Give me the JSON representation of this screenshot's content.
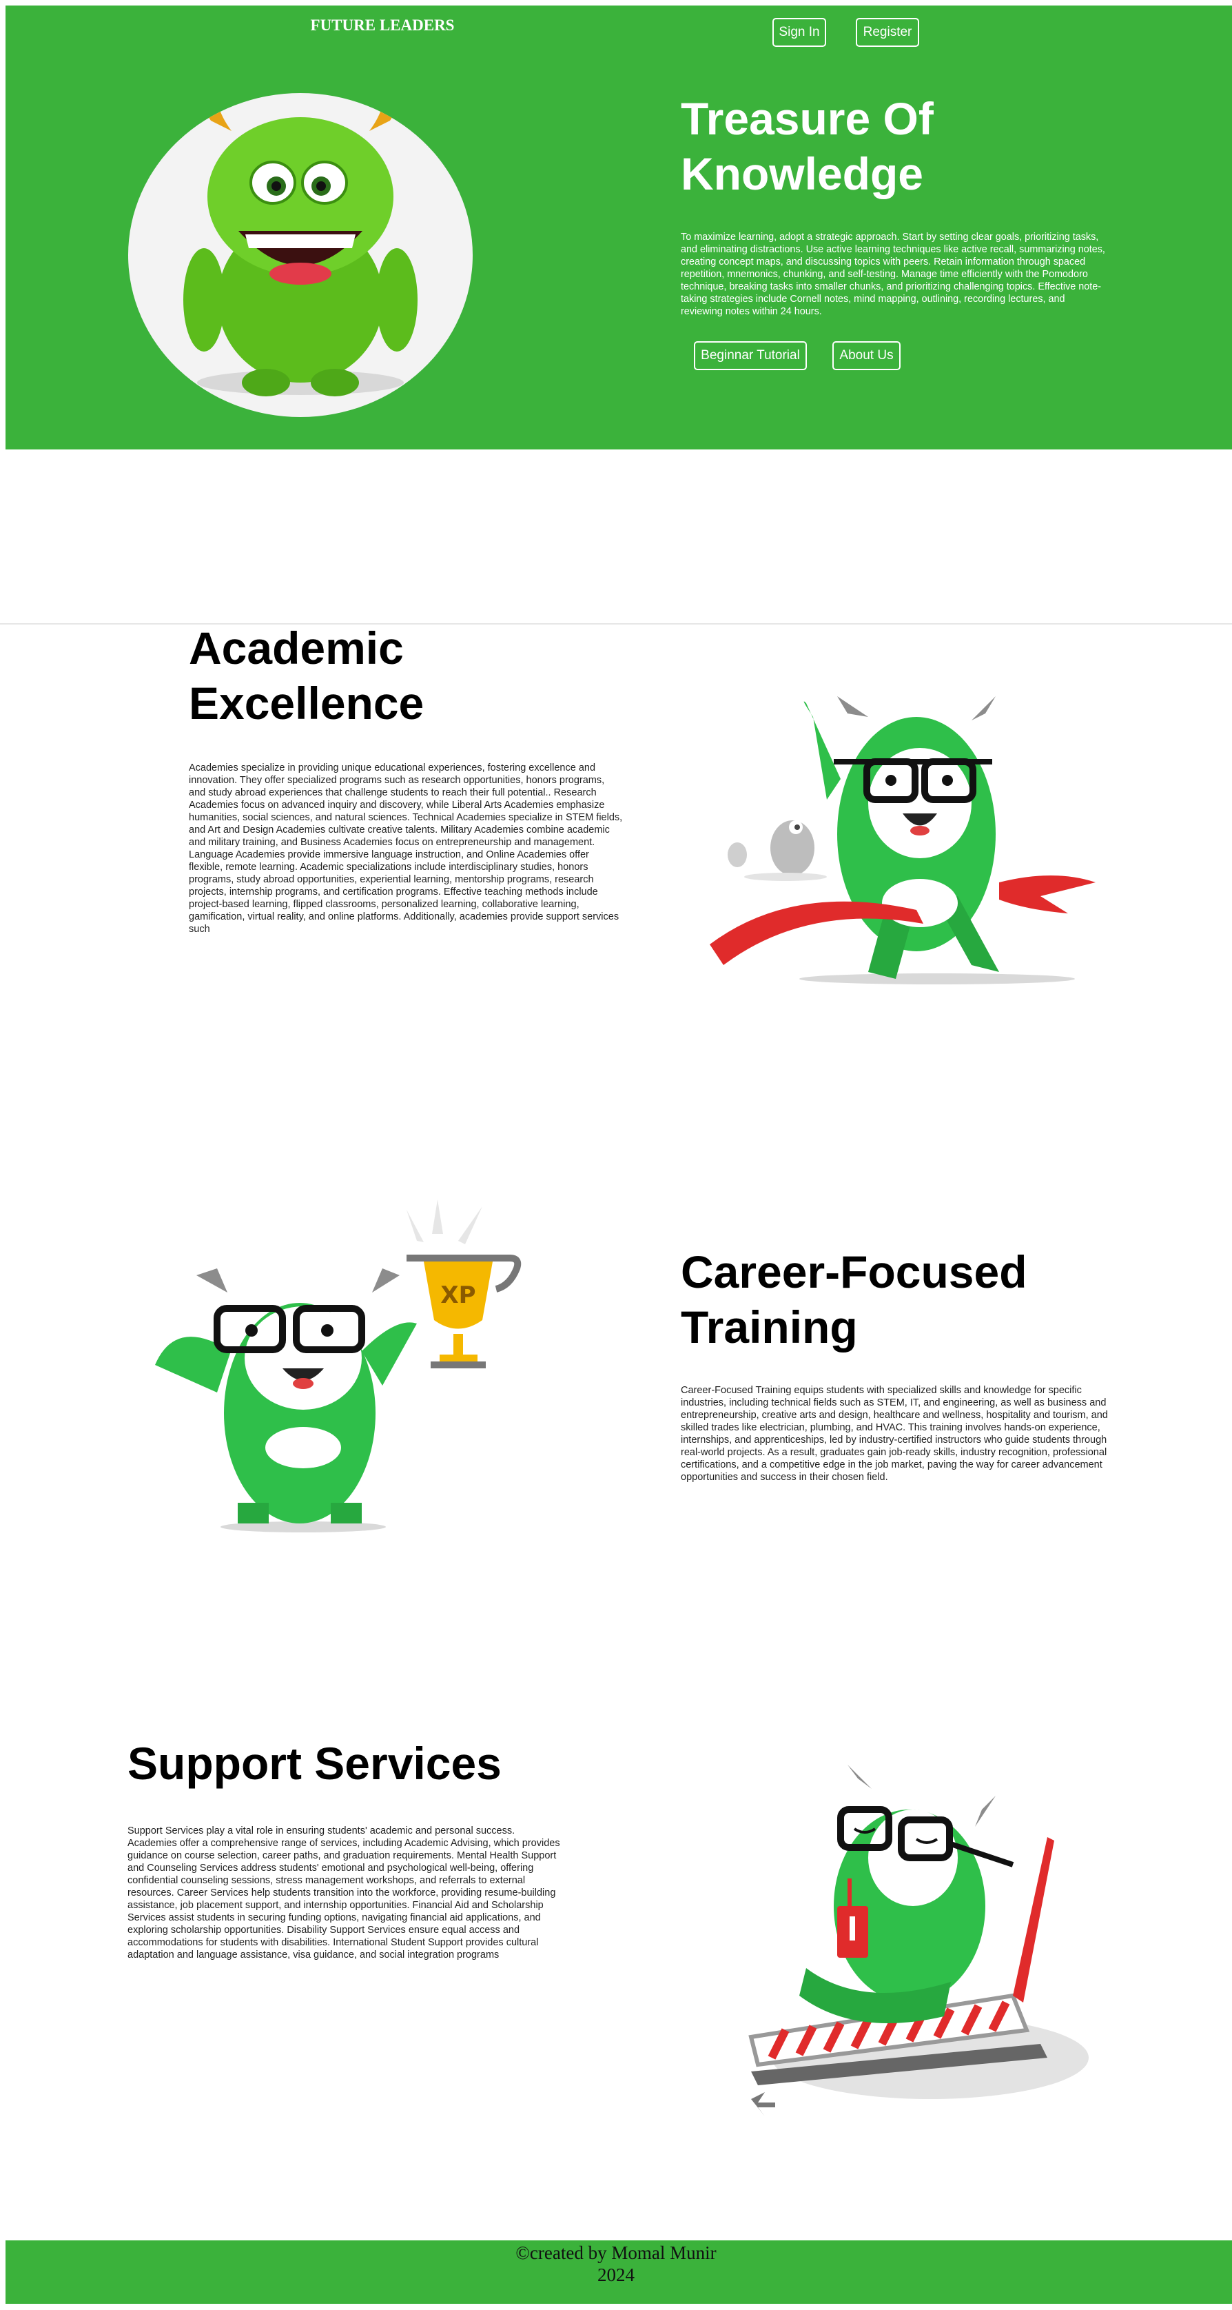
{
  "header": {
    "brand": "FUTURE LEADERS",
    "signin_label": "Sign In",
    "register_label": "Register"
  },
  "hero": {
    "title": "Treasure Of Knowledge",
    "text": "To maximize learning, adopt a strategic approach. Start by setting clear goals, prioritizing tasks, and eliminating distractions. Use active learning techniques like active recall, summarizing notes, creating concept maps, and discussing topics with peers. Retain information through spaced repetition, mnemonics, chunking, and self-testing. Manage time efficiently with the Pomodoro technique, breaking tasks into smaller chunks, and prioritizing challenging topics. Effective note-taking strategies include Cornell notes, mind mapping, outlining, recording lectures, and reviewing notes within 24 hours.",
    "tutorial_label": "Beginnar Tutorial",
    "about_label": "About Us"
  },
  "sections": [
    {
      "title": "Academic Excellence",
      "text": "Academies specialize in providing unique educational experiences, fostering excellence and innovation. They offer specialized programs such as research opportunities, honors programs, and study abroad experiences that challenge students to reach their full potential.. Research Academies focus on advanced inquiry and discovery, while Liberal Arts Academies emphasize humanities, social sciences, and natural sciences. Technical Academies specialize in STEM fields, and Art and Design Academies cultivate creative talents. Military Academies combine academic and military training, and Business Academies focus on entrepreneurship and management. Language Academies provide immersive language instruction, and Online Academies offer flexible, remote learning. Academic specializations include interdisciplinary studies, honors programs, study abroad opportunities, experiential learning, mentorship programs, research projects, internship programs, and certification programs. Effective teaching methods include project-based learning, flipped classrooms, personalized learning, collaborative learning, gamification, virtual reality, and online platforms. Additionally, academies provide support services such"
    },
    {
      "title": "Career-Focused Training",
      "text": "Career-Focused Training equips students with specialized skills and knowledge for specific industries, including technical fields such as STEM, IT, and engineering, as well as business and entrepreneurship, creative arts and design, healthcare and wellness, hospitality and tourism, and skilled trades like electrician, plumbing, and HVAC. This training involves hands-on experience, internships, and apprenticeships, led by industry-certified instructors who guide students through real-world projects. As a result, graduates gain job-ready skills, industry recognition, professional certifications, and a competitive edge in the job market, paving the way for career advancement opportunities and success in their chosen field."
    },
    {
      "title": "Support Services",
      "text": "Support Services play a vital role in ensuring students' academic and personal success. Academies offer a comprehensive range of services, including Academic Advising, which provides guidance on course selection, career paths, and graduation requirements. Mental Health Support and Counseling Services address students' emotional and psychological well-being, offering confidential counseling sessions, stress management workshops, and referrals to external resources. Career Services help students transition into the workforce, providing resume-building assistance, job placement support, and internship opportunities. Financial Aid and Scholarship Services assist students in securing funding options, navigating financial aid applications, and exploring scholarship opportunities. Disability Support Services ensure equal access and accommodations for students with disabilities. International Student Support provides cultural adaptation and language assistance, visa guidance, and social integration programs"
    }
  ],
  "illustrations": {
    "trophy_text": "XP"
  },
  "footer": {
    "text": "©created by Momal Munir 2024"
  },
  "colors": {
    "brand_green": "#3bb23b",
    "monster_green": "#2fbf4a",
    "ribbon_red": "#e02b2b",
    "trophy_gold": "#f5b800"
  }
}
